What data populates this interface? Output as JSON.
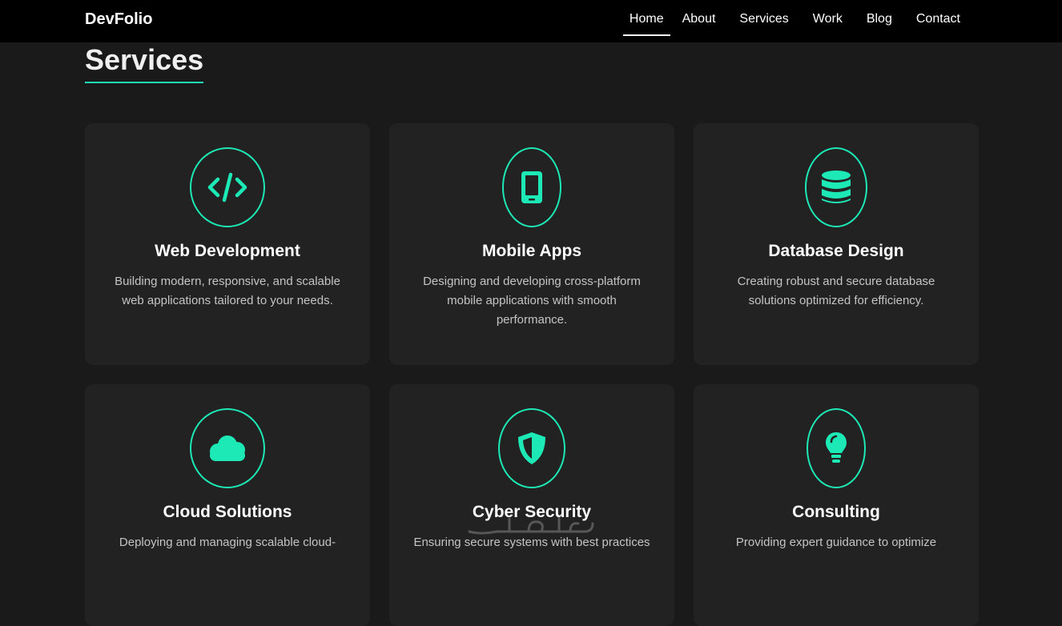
{
  "brand": "DevFolio",
  "nav": {
    "items": [
      {
        "label": "Home",
        "active": true
      },
      {
        "label": "About"
      },
      {
        "label": "Services"
      },
      {
        "label": "Work"
      },
      {
        "label": "Blog"
      },
      {
        "label": "Contact"
      }
    ]
  },
  "section": {
    "title": "Services"
  },
  "colors": {
    "accent": "#1de9b6",
    "background": "#1a1a1a",
    "card": "#222222",
    "navbar": "#000000"
  },
  "services": [
    {
      "icon": "code-icon",
      "title": "Web Development",
      "description": "Building modern, responsive, and scalable web applications tailored to your needs."
    },
    {
      "icon": "mobile-icon",
      "title": "Mobile Apps",
      "description": "Designing and developing cross-platform mobile applications with smooth performance."
    },
    {
      "icon": "database-icon",
      "title": "Database Design",
      "description": "Creating robust and secure database solutions optimized for efficiency."
    },
    {
      "icon": "cloud-icon",
      "title": "Cloud Solutions",
      "description": "Deploying and managing scalable cloud-"
    },
    {
      "icon": "shield-icon",
      "title": "Cyber Security",
      "description": "Ensuring secure systems with best practices"
    },
    {
      "icon": "lightbulb-icon",
      "title": "Consulting",
      "description": "Providing expert guidance to optimize"
    }
  ]
}
